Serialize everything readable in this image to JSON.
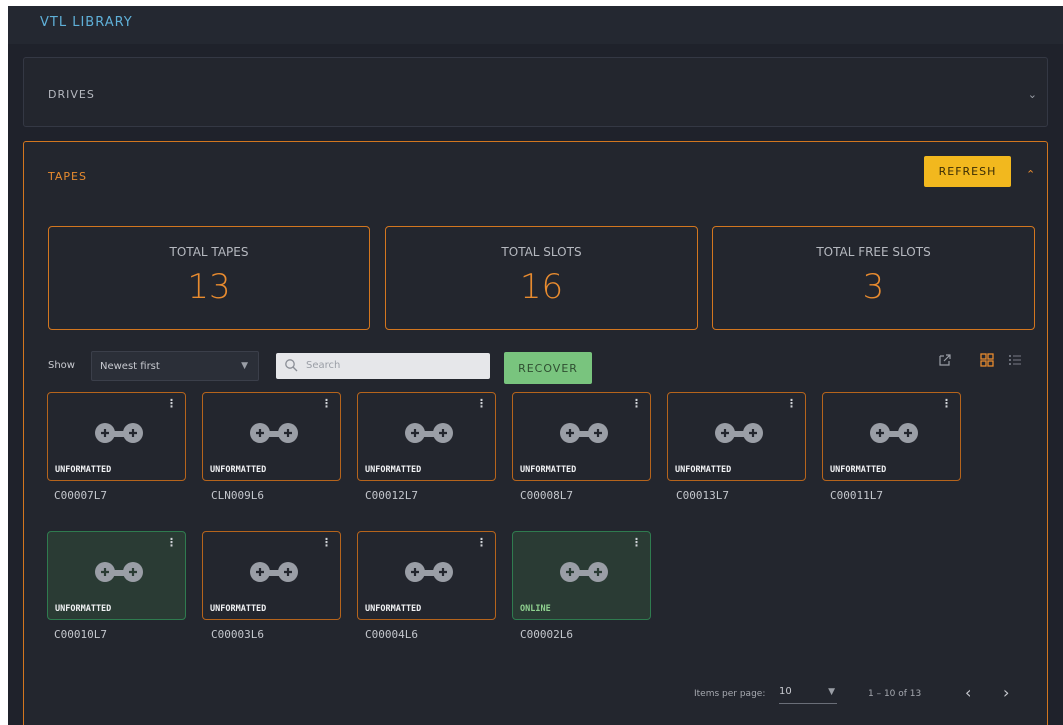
{
  "app": {
    "title": "VTL LIBRARY"
  },
  "drives": {
    "label": "DRIVES"
  },
  "tapes": {
    "label": "TAPES",
    "refresh_label": "REFRESH",
    "stats": [
      {
        "label": "TOTAL TAPES",
        "value": "13"
      },
      {
        "label": "TOTAL SLOTS",
        "value": "16"
      },
      {
        "label": "TOTAL FREE SLOTS",
        "value": "3"
      }
    ],
    "toolbar": {
      "show_label": "Show",
      "sort_value": "Newest first",
      "search_placeholder": "Search",
      "recover_label": "RECOVER"
    },
    "items": [
      {
        "id": "C00007L7",
        "status": "UNFORMATTED"
      },
      {
        "id": "CLN009L6",
        "status": "UNFORMATTED"
      },
      {
        "id": "C00012L7",
        "status": "UNFORMATTED"
      },
      {
        "id": "C00008L7",
        "status": "UNFORMATTED"
      },
      {
        "id": "C00013L7",
        "status": "UNFORMATTED"
      },
      {
        "id": "C00011L7",
        "status": "UNFORMATTED"
      },
      {
        "id": "C00010L7",
        "status": "UNFORMATTED"
      },
      {
        "id": "C00003L6",
        "status": "UNFORMATTED"
      },
      {
        "id": "C00004L6",
        "status": "UNFORMATTED"
      },
      {
        "id": "C00002L6",
        "status": "ONLINE"
      }
    ],
    "pagination": {
      "items_per_page_label": "Items per page:",
      "items_per_page_value": "10",
      "range": "1 – 10 of 13"
    }
  },
  "colors": {
    "accent": "#e88b2f",
    "refresh": "#f2b81e",
    "recover": "#79c47e",
    "online": "#8fd18f"
  }
}
